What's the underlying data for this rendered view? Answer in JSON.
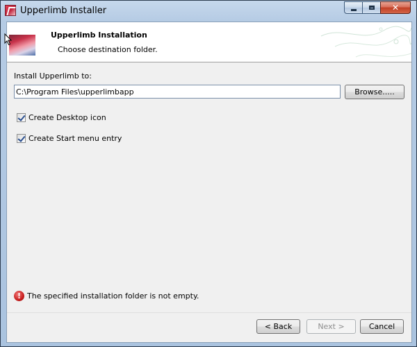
{
  "window": {
    "title": "Upperlimb Installer",
    "icon": "app-logo-icon"
  },
  "header": {
    "title": "Upperlimb Installation",
    "subtitle": "Choose destination folder."
  },
  "install": {
    "label": "Install Upperlimb to:",
    "path": "C:\\Program Files\\upperlimbapp",
    "browse_label": "Browse....."
  },
  "options": {
    "desktop_icon": {
      "label": "Create Desktop icon",
      "checked": true
    },
    "start_menu": {
      "label": "Create Start menu entry",
      "checked": true
    }
  },
  "status": {
    "message": "The specified installation folder is not empty.",
    "icon": "error-icon",
    "color": "#c81e1e"
  },
  "buttons": {
    "back": "< Back",
    "next": "Next >",
    "cancel": "Cancel"
  }
}
